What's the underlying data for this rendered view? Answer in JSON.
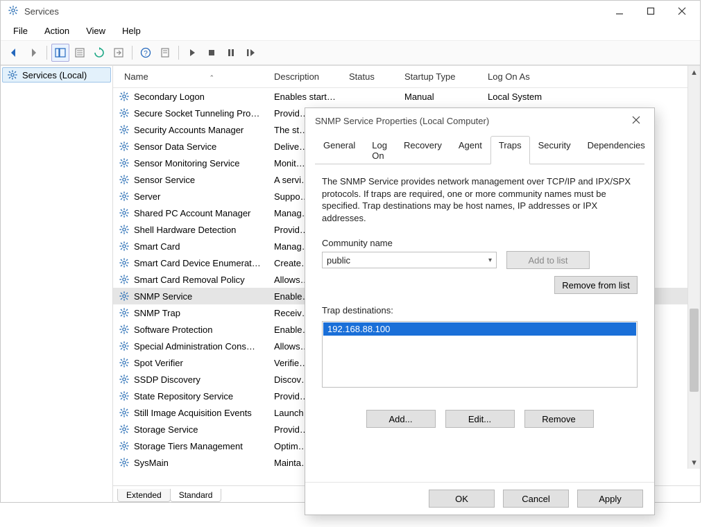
{
  "window": {
    "title": "Services",
    "menu": [
      "File",
      "Action",
      "View",
      "Help"
    ],
    "tree_item": "Services (Local)",
    "bottom_tabs": {
      "extended": "Extended",
      "standard": "Standard",
      "active": "Standard"
    }
  },
  "columns": {
    "name": "Name",
    "description": "Description",
    "status": "Status",
    "startup": "Startup Type",
    "logon": "Log On As"
  },
  "rows": [
    {
      "name": "Secondary Logon",
      "desc": "Enables start…",
      "status": "",
      "startup": "Manual",
      "logon": "Local System",
      "selected": false
    },
    {
      "name": "Secure Socket Tunneling Pro…",
      "desc": "Provid…",
      "status": "",
      "startup": "",
      "logon": "",
      "selected": false
    },
    {
      "name": "Security Accounts Manager",
      "desc": "The st…",
      "status": "",
      "startup": "",
      "logon": "",
      "selected": false
    },
    {
      "name": "Sensor Data Service",
      "desc": "Delive…",
      "status": "",
      "startup": "",
      "logon": "",
      "selected": false
    },
    {
      "name": "Sensor Monitoring Service",
      "desc": "Monit…",
      "status": "",
      "startup": "",
      "logon": "",
      "selected": false
    },
    {
      "name": "Sensor Service",
      "desc": "A servi…",
      "status": "",
      "startup": "",
      "logon": "",
      "selected": false
    },
    {
      "name": "Server",
      "desc": "Suppo…",
      "status": "",
      "startup": "",
      "logon": "",
      "selected": false
    },
    {
      "name": "Shared PC Account Manager",
      "desc": "Manag…",
      "status": "",
      "startup": "",
      "logon": "",
      "selected": false
    },
    {
      "name": "Shell Hardware Detection",
      "desc": "Provid…",
      "status": "",
      "startup": "",
      "logon": "",
      "selected": false
    },
    {
      "name": "Smart Card",
      "desc": "Manag…",
      "status": "",
      "startup": "",
      "logon": "",
      "selected": false
    },
    {
      "name": "Smart Card Device Enumerat…",
      "desc": "Create…",
      "status": "",
      "startup": "",
      "logon": "",
      "selected": false
    },
    {
      "name": "Smart Card Removal Policy",
      "desc": "Allows…",
      "status": "",
      "startup": "",
      "logon": "",
      "selected": false
    },
    {
      "name": "SNMP Service",
      "desc": "Enable…",
      "status": "",
      "startup": "",
      "logon": "",
      "selected": true
    },
    {
      "name": "SNMP Trap",
      "desc": "Receiv…",
      "status": "",
      "startup": "",
      "logon": "",
      "selected": false
    },
    {
      "name": "Software Protection",
      "desc": "Enable…",
      "status": "",
      "startup": "",
      "logon": "",
      "selected": false
    },
    {
      "name": "Special Administration Cons…",
      "desc": "Allows…",
      "status": "",
      "startup": "",
      "logon": "",
      "selected": false
    },
    {
      "name": "Spot Verifier",
      "desc": "Verifie…",
      "status": "",
      "startup": "",
      "logon": "",
      "selected": false
    },
    {
      "name": "SSDP Discovery",
      "desc": "Discov…",
      "status": "",
      "startup": "",
      "logon": "",
      "selected": false
    },
    {
      "name": "State Repository Service",
      "desc": "Provid…",
      "status": "",
      "startup": "",
      "logon": "",
      "selected": false
    },
    {
      "name": "Still Image Acquisition Events",
      "desc": "Launch…",
      "status": "",
      "startup": "",
      "logon": "",
      "selected": false
    },
    {
      "name": "Storage Service",
      "desc": "Provid…",
      "status": "",
      "startup": "",
      "logon": "",
      "selected": false
    },
    {
      "name": "Storage Tiers Management",
      "desc": "Optim…",
      "status": "",
      "startup": "",
      "logon": "",
      "selected": false
    },
    {
      "name": "SysMain",
      "desc": "Mainta…",
      "status": "",
      "startup": "",
      "logon": "",
      "selected": false
    }
  ],
  "dialog": {
    "title": "SNMP Service Properties (Local Computer)",
    "tabs": [
      "General",
      "Log On",
      "Recovery",
      "Agent",
      "Traps",
      "Security",
      "Dependencies"
    ],
    "active_tab": "Traps",
    "description": "The SNMP Service provides network management over TCP/IP and IPX/SPX protocols. If traps are required, one or more community names must be specified. Trap destinations may be host names, IP addresses or IPX addresses.",
    "community_label": "Community name",
    "community_value": "public",
    "add_to_list": "Add to list",
    "remove_from_list": "Remove from list",
    "trap_label": "Trap destinations:",
    "trap_items": [
      "192.168.88.100"
    ],
    "add": "Add...",
    "edit": "Edit...",
    "remove": "Remove",
    "ok": "OK",
    "cancel": "Cancel",
    "apply": "Apply"
  }
}
